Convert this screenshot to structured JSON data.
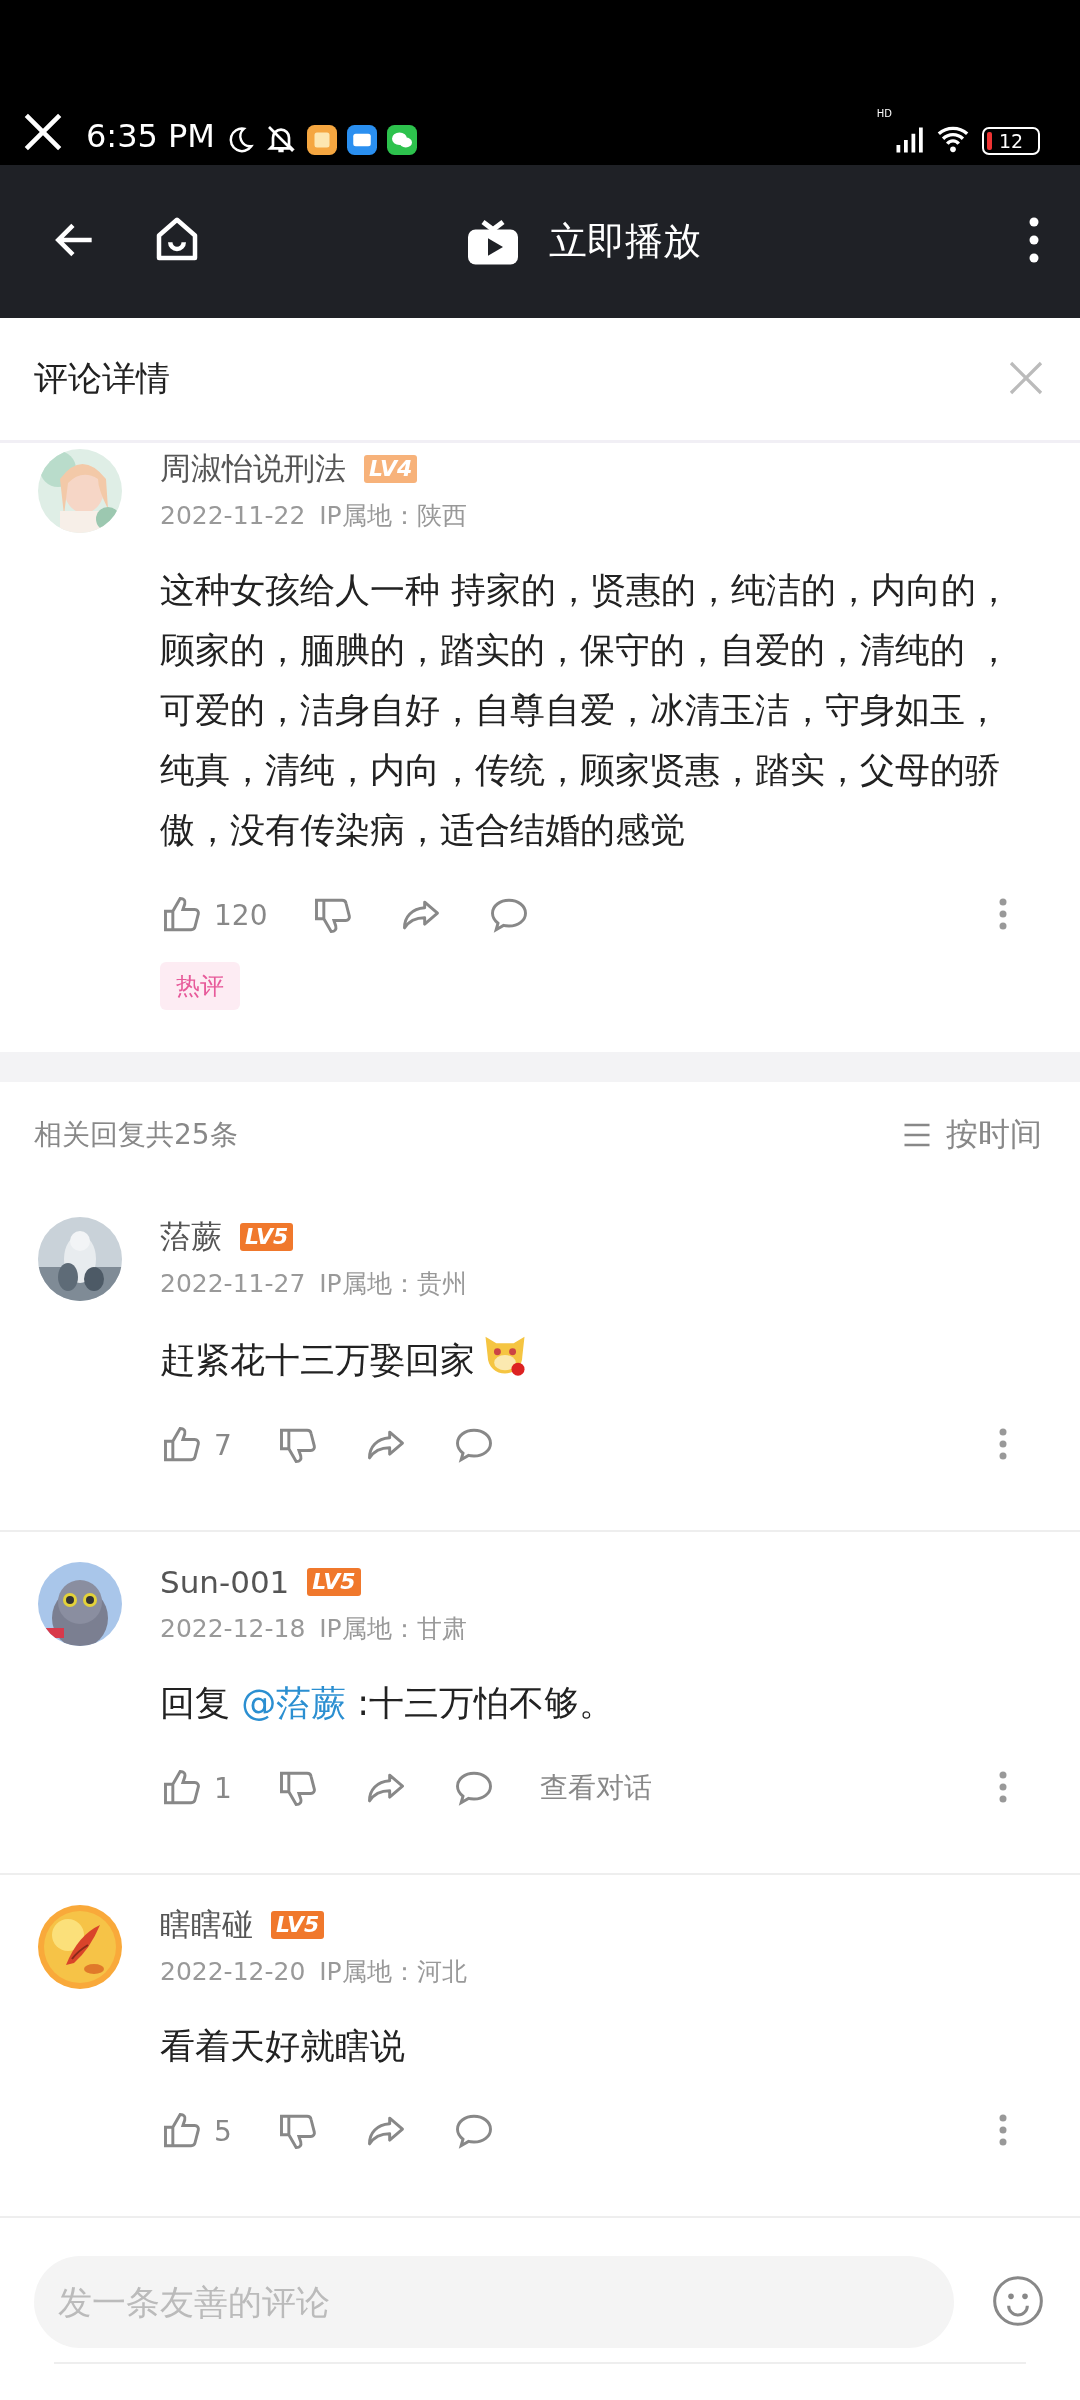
{
  "status_bar": {
    "time": "6:35 PM",
    "hd": "HD",
    "battery": "12"
  },
  "nav": {
    "title": "立即播放"
  },
  "sheet": {
    "title": "评论详情"
  },
  "main_comment": {
    "user": "周淑怡说刑法",
    "badge": "LV4",
    "color": "#f7b27a",
    "date": "2022-11-22",
    "location": "IP属地：陕西",
    "text": "这种女孩给人一种 持家的，贤惠的，纯洁的，内向的，顾家的，腼腆的，踏实的，保守的，自爱的，清纯的 ，可爱的，洁身自好，自尊自爱，冰清玉洁，守身如玉，纯真，清纯，内向，传统，顾家贤惠，踏实，父母的骄傲，没有传染病，适合结婚的感觉",
    "likes": "120",
    "tag": "热评"
  },
  "replies_header": {
    "count": "相关回复共25条",
    "sort": "按时间"
  },
  "replies": [
    {
      "user": "菭蕨",
      "badge": "LV5",
      "color": "#f0782c",
      "date": "2022-11-27",
      "location": "IP属地：贵州",
      "text": "赶紧花十三万娶回家",
      "sticker": true,
      "likes": "7"
    },
    {
      "user": "Sun-001",
      "badge": "LV5",
      "color": "#f0782c",
      "date": "2022-12-18",
      "location": "IP属地：甘肃",
      "prefix": "回复 ",
      "mention": "@菭蕨",
      "text": " :十三万怕不够。",
      "sticker": false,
      "likes": "1",
      "view_conversation": "查看对话"
    },
    {
      "user": "瞎瞎碰",
      "badge": "LV5",
      "color": "#f0782c",
      "date": "2022-12-20",
      "location": "IP属地：河北",
      "text": "看着天好就瞎说",
      "sticker": false,
      "likes": "5"
    }
  ],
  "input": {
    "placeholder": "发一条友善的评论"
  }
}
